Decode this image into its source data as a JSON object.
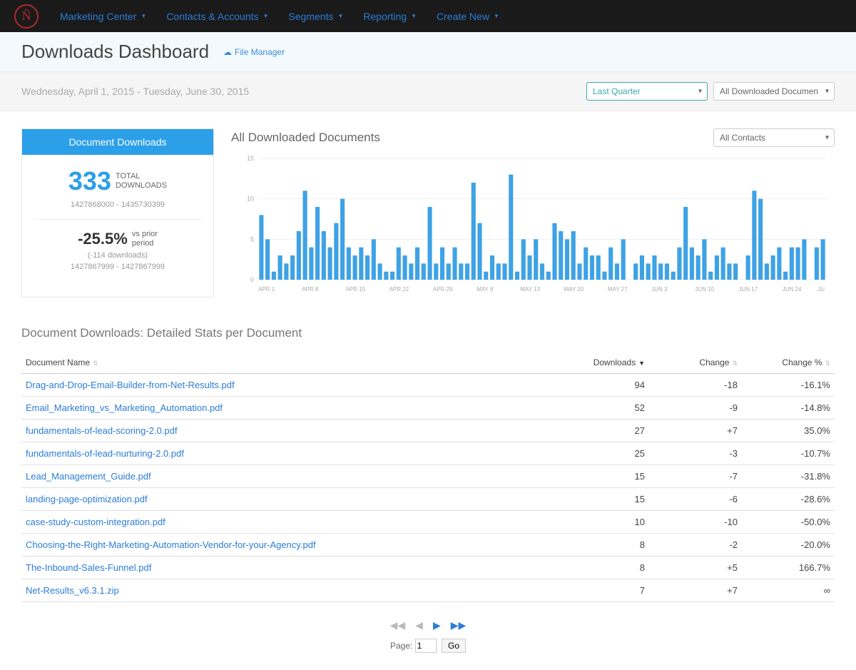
{
  "nav": {
    "items": [
      "Marketing Center",
      "Contacts & Accounts",
      "Segments",
      "Reporting",
      "Create New"
    ]
  },
  "header": {
    "title": "Downloads Dashboard",
    "file_manager": "File Manager"
  },
  "date_row": {
    "range": "Wednesday, April 1, 2015   -   Tuesday, June 30, 2015",
    "period_sel": "Last Quarter",
    "doc_sel": "All Downloaded Documents"
  },
  "card": {
    "title": "Document Downloads",
    "total": "333",
    "total_label": "TOTAL\nDOWNLOADS",
    "ids1": "1427868000  -  1435730399",
    "pct": "-25.5%",
    "pct_label": "vs prior\nperiod",
    "delta": "(-114 downloads)",
    "ids2": "1427867999  -  1427867999"
  },
  "chart": {
    "title": "All Downloaded Documents",
    "contact_sel": "All Contacts"
  },
  "chart_data": {
    "type": "bar",
    "title": "All Downloaded Documents",
    "xlabel": "",
    "ylabel": "",
    "ylim": [
      0,
      15
    ],
    "yticks": [
      0,
      5,
      10,
      15
    ],
    "xticks": [
      "APR 1",
      "APR 8",
      "APR 15",
      "APR 22",
      "APR 29",
      "MAY 6",
      "MAY 13",
      "MAY 20",
      "MAY 27",
      "JUN 3",
      "JUN 10",
      "JUN 17",
      "JUN 24",
      "JU"
    ],
    "values": [
      8,
      5,
      1,
      3,
      2,
      3,
      6,
      11,
      4,
      9,
      6,
      4,
      7,
      10,
      4,
      3,
      4,
      3,
      5,
      2,
      1,
      1,
      4,
      3,
      2,
      4,
      2,
      9,
      2,
      4,
      2,
      4,
      2,
      2,
      12,
      7,
      1,
      3,
      2,
      2,
      13,
      1,
      5,
      3,
      5,
      2,
      1,
      7,
      6,
      5,
      6,
      2,
      4,
      3,
      3,
      1,
      4,
      2,
      5,
      0,
      2,
      3,
      2,
      3,
      2,
      2,
      1,
      4,
      9,
      4,
      3,
      5,
      1,
      3,
      4,
      2,
      2,
      0,
      3,
      11,
      10,
      2,
      3,
      4,
      1,
      4,
      4,
      5,
      0,
      4,
      5
    ]
  },
  "table": {
    "title": "Document Downloads: Detailed Stats per Document",
    "cols": [
      "Document Name",
      "Downloads",
      "Change",
      "Change %"
    ],
    "rows": [
      {
        "name": "Drag-and-Drop-Email-Builder-from-Net-Results.pdf",
        "downloads": "94",
        "change": "-18",
        "pct": "-16.1%"
      },
      {
        "name": "Email_Marketing_vs_Marketing_Automation.pdf",
        "downloads": "52",
        "change": "-9",
        "pct": "-14.8%"
      },
      {
        "name": "fundamentals-of-lead-scoring-2.0.pdf",
        "downloads": "27",
        "change": "+7",
        "pct": "35.0%"
      },
      {
        "name": "fundamentals-of-lead-nurturing-2.0.pdf",
        "downloads": "25",
        "change": "-3",
        "pct": "-10.7%"
      },
      {
        "name": "Lead_Management_Guide.pdf",
        "downloads": "15",
        "change": "-7",
        "pct": "-31.8%"
      },
      {
        "name": "landing-page-optimization.pdf",
        "downloads": "15",
        "change": "-6",
        "pct": "-28.6%"
      },
      {
        "name": "case-study-custom-integration.pdf",
        "downloads": "10",
        "change": "-10",
        "pct": "-50.0%"
      },
      {
        "name": "Choosing-the-Right-Marketing-Automation-Vendor-for-your-Agency.pdf",
        "downloads": "8",
        "change": "-2",
        "pct": "-20.0%"
      },
      {
        "name": "The-Inbound-Sales-Funnel.pdf",
        "downloads": "8",
        "change": "+5",
        "pct": "166.7%"
      },
      {
        "name": "Net-Results_v6.3.1.zip",
        "downloads": "7",
        "change": "+7",
        "pct": "∞"
      }
    ]
  },
  "pager": {
    "page_label": "Page:",
    "page_value": "1",
    "go_label": "Go"
  }
}
